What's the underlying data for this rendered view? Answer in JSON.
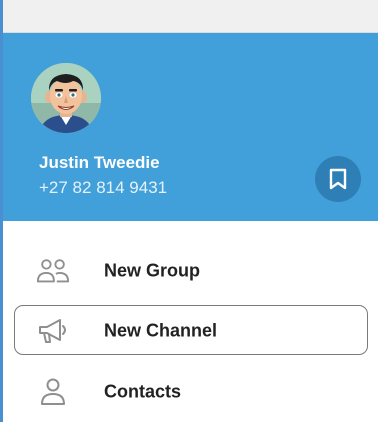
{
  "colors": {
    "header_bg": "#419fd9",
    "saved_button_bg": "#2f7fb7",
    "icon_gray": "#8f8f8f",
    "text_dark": "#222222"
  },
  "profile": {
    "name": "Justin Tweedie",
    "phone": "+27 82 814 9431",
    "avatar_icon": "cartoon-avatar"
  },
  "saved_messages": {
    "icon": "bookmark-icon"
  },
  "menu": {
    "items": [
      {
        "label": "New Group",
        "icon": "group-icon",
        "selected": false
      },
      {
        "label": "New Channel",
        "icon": "megaphone-icon",
        "selected": true
      },
      {
        "label": "Contacts",
        "icon": "person-icon",
        "selected": false
      }
    ]
  }
}
